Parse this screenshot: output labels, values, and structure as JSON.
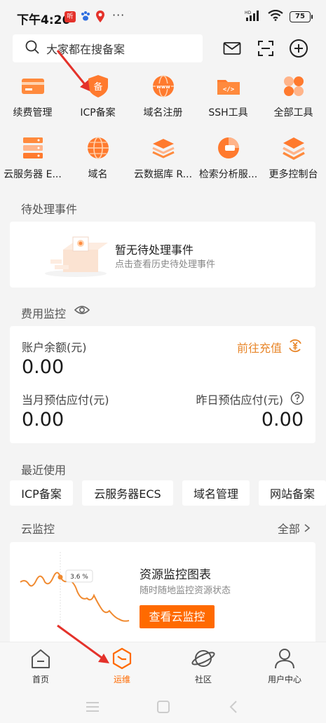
{
  "status_bar": {
    "time": "下午4:26",
    "app_badge": "听",
    "battery": "75",
    "network": "HD"
  },
  "search": {
    "placeholder": "大家都在搜备案"
  },
  "header_icons": [
    "mail-icon",
    "scan-icon",
    "add-icon"
  ],
  "tools": [
    {
      "label": "续费管理",
      "icon": "renew-icon"
    },
    {
      "label": "ICP备案",
      "icon": "icp-icon"
    },
    {
      "label": "域名注册",
      "icon": "domain-register-icon"
    },
    {
      "label": "SSH工具",
      "icon": "ssh-icon"
    },
    {
      "label": "全部工具",
      "icon": "all-tools-icon"
    },
    {
      "label": "云服务器 E...",
      "icon": "ecs-icon"
    },
    {
      "label": "域名",
      "icon": "domain-icon"
    },
    {
      "label": "云数据库 R...",
      "icon": "rds-icon"
    },
    {
      "label": "检索分析服...",
      "icon": "search-analysis-icon"
    },
    {
      "label": "更多控制台",
      "icon": "more-console-icon"
    }
  ],
  "pending": {
    "section_title": "待处理事件",
    "title": "暂无待处理事件",
    "subtitle": "点击查看历史待处理事件"
  },
  "fee": {
    "section_title": "费用监控",
    "balance_label": "账户余额(元)",
    "balance_value": "0.00",
    "topup_label": "前往充值",
    "month_label": "当月预估应付(元)",
    "month_value": "0.00",
    "yesterday_label": "昨日预估应付(元)",
    "yesterday_value": "0.00"
  },
  "recent": {
    "section_title": "最近使用",
    "items": [
      "ICP备案",
      "云服务器ECS",
      "域名管理",
      "网站备案"
    ]
  },
  "monitor": {
    "section_title": "云监控",
    "all_label": "全部",
    "title": "资源监控图表",
    "subtitle": "随时随地监控资源状态",
    "button": "查看云监控",
    "tooltip": "3.6 %"
  },
  "tabs": [
    {
      "label": "首页",
      "icon": "home-icon",
      "active": false
    },
    {
      "label": "运维",
      "icon": "ops-icon",
      "active": true
    },
    {
      "label": "社区",
      "icon": "community-icon",
      "active": false
    },
    {
      "label": "用户中心",
      "icon": "user-icon",
      "active": false
    }
  ],
  "colors": {
    "accent": "#ff6a00",
    "arrow": "#e4322b",
    "orange_text": "#e8862a"
  }
}
